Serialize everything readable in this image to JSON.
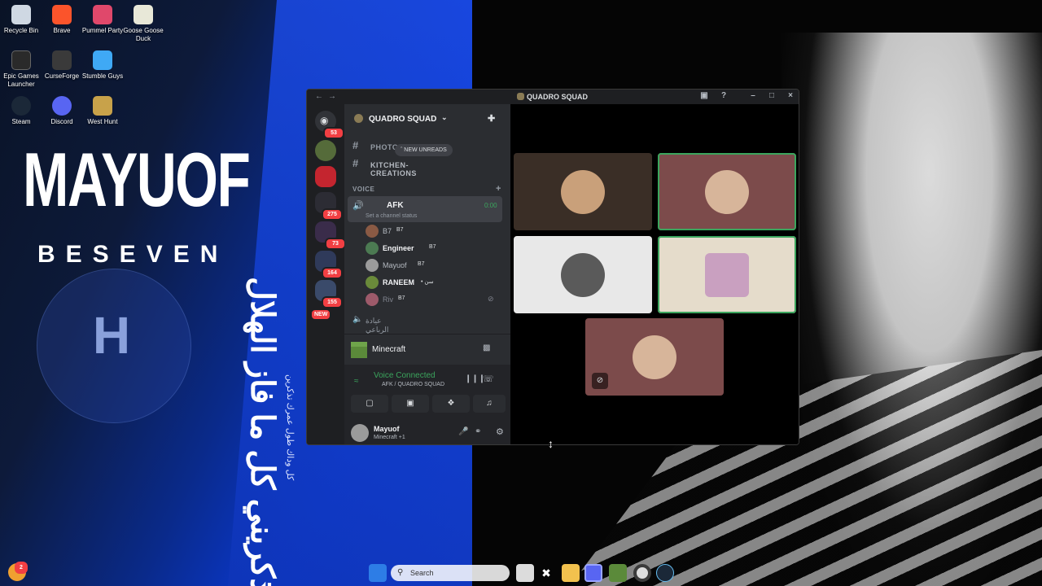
{
  "wallpaper": {
    "brand_title": "MAYUOF",
    "brand_subtitle": "BESEVEN",
    "arabic_big": "اذكريني كل ما فاز الهلال",
    "arabic_small": "كل وداك طول عمرك تذكرين"
  },
  "desktop_icons": [
    {
      "label": "Recycle Bin",
      "icon": "recycle-bin-icon",
      "color": "#cfd8e3"
    },
    {
      "label": "Brave",
      "icon": "brave-icon",
      "color": "#fb542b"
    },
    {
      "label": "Pummel Party",
      "icon": "pummel-party-icon",
      "color": "#e0486b"
    },
    {
      "label": "Goose Goose Duck",
      "icon": "goose-icon",
      "color": "#e8e8d8"
    },
    {
      "label": "Epic Games Launcher",
      "icon": "epic-games-icon",
      "color": "#2a2a2a"
    },
    {
      "label": "CurseForge",
      "icon": "curseforge-icon",
      "color": "#3a3a3a"
    },
    {
      "label": "Stumble Guys",
      "icon": "stumble-guys-icon",
      "color": "#3fa9f5"
    },
    {
      "label": "Steam",
      "icon": "steam-icon",
      "color": "#1b2838"
    },
    {
      "label": "Discord",
      "icon": "discord-icon",
      "color": "#5865f2"
    },
    {
      "label": "West Hunt",
      "icon": "west-hunt-icon",
      "color": "#c8a24a"
    }
  ],
  "discord": {
    "window_title": "QUADRO SQUAD",
    "server_name": "QUADRO SQUAD",
    "dm_badge": "53",
    "rail_badges": [
      "275",
      "73",
      "164",
      "155"
    ],
    "rail_new_label": "NEW",
    "new_unreads_label": "NEW UNREADS",
    "text_channels": [
      "PHOTOGRAPHY",
      "KITCHEN-CREATIONS"
    ],
    "voice_category": "VOICE",
    "active_channel": "AFK",
    "active_channel_timer": "0:00",
    "channel_status_placeholder": "Set a channel status",
    "voice_users": [
      {
        "name": "B7",
        "tag": "B7",
        "color": "#8a5a44",
        "bold": false
      },
      {
        "name": "Engineer",
        "tag": "B7",
        "color": "#4c7a52",
        "bold": true
      },
      {
        "name": "Mayuof",
        "tag": "B7",
        "color": "#9b9b9b",
        "bold": false
      },
      {
        "name": "RANEEM",
        "tag": "• سن",
        "color": "#6a8a3a",
        "bold": true
      },
      {
        "name": "Riv",
        "tag": "B7",
        "color": "#9d5a6a",
        "bold": false
      }
    ],
    "next_channel": "عيادة الرباعي",
    "activity": {
      "game": "Minecraft"
    },
    "voice_status": {
      "label": "Voice Connected",
      "location": "AFK / QUADRO SQUAD",
      "color": "#3ba55d"
    },
    "user_panel": {
      "username": "Mayuof",
      "status": "Minecraft +1"
    },
    "tiles": [
      {
        "bg": "#3a2e26",
        "avatar": "#c9a07a",
        "speaking": false,
        "muted": false
      },
      {
        "bg": "#7c4b4b",
        "avatar": "#d7b59a",
        "speaking": true,
        "muted": false
      },
      {
        "bg": "#e8e8e8",
        "avatar": "#5a5a5a",
        "speaking": false,
        "muted": false
      },
      {
        "bg": "#e5dccb",
        "avatar": "#c9a0c0",
        "speaking": true,
        "muted": false
      },
      {
        "bg": "#7c4b4b",
        "avatar": "#d7b59a",
        "speaking": false,
        "muted": true
      }
    ]
  },
  "taskbar": {
    "search_placeholder": "Search",
    "apps": [
      "start-icon",
      "file-explorer-icon",
      "capcut-icon",
      "folder-icon",
      "discord-icon",
      "minecraft-icon",
      "chrome-icon",
      "steam-icon"
    ],
    "notification_count": "2"
  }
}
